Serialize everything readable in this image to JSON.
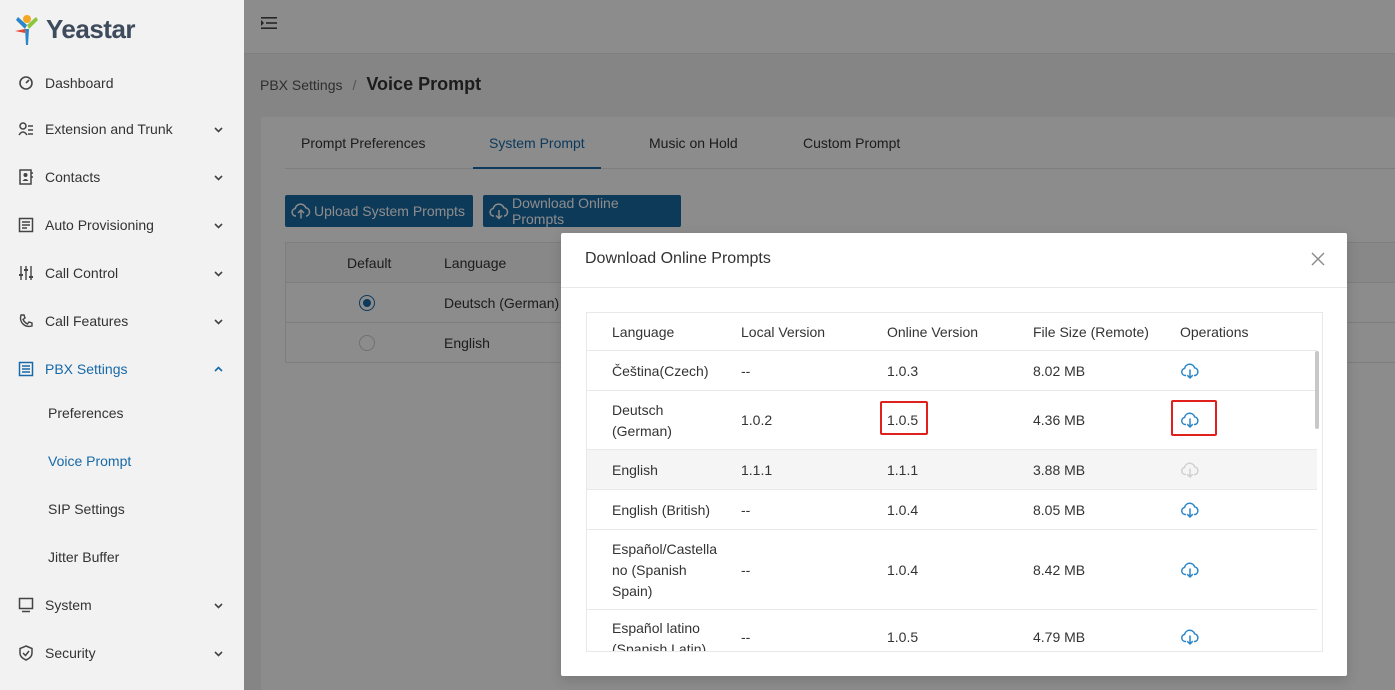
{
  "brand": {
    "name": "Yeastar"
  },
  "sidebar": {
    "items": [
      {
        "label": "Dashboard",
        "icon": "dashboard-icon"
      },
      {
        "label": "Extension and Trunk",
        "icon": "extension-icon"
      },
      {
        "label": "Contacts",
        "icon": "contacts-icon"
      },
      {
        "label": "Auto Provisioning",
        "icon": "provisioning-icon"
      },
      {
        "label": "Call Control",
        "icon": "call-control-icon"
      },
      {
        "label": "Call Features",
        "icon": "phone-icon"
      },
      {
        "label": "PBX Settings",
        "icon": "pbx-settings-icon"
      },
      {
        "label": "System",
        "icon": "system-icon"
      },
      {
        "label": "Security",
        "icon": "shield-icon"
      }
    ],
    "sub_items": [
      {
        "label": "Preferences"
      },
      {
        "label": "Voice Prompt"
      },
      {
        "label": "SIP Settings"
      },
      {
        "label": "Jitter Buffer"
      }
    ]
  },
  "breadcrumb": {
    "parent": "PBX Settings",
    "separator": "/",
    "current": "Voice Prompt"
  },
  "tabs": [
    {
      "label": "Prompt Preferences"
    },
    {
      "label": "System Prompt"
    },
    {
      "label": "Music on Hold"
    },
    {
      "label": "Custom Prompt"
    }
  ],
  "toolbar": {
    "upload_label": "Upload System Prompts",
    "download_label": "Download Online Prompts"
  },
  "bg_table": {
    "headers": {
      "default": "Default",
      "language": "Language"
    },
    "rows": [
      {
        "language": "Deutsch (German)",
        "default": true
      },
      {
        "language": "English",
        "default": false
      }
    ]
  },
  "modal": {
    "title": "Download Online Prompts",
    "headers": {
      "language": "Language",
      "local": "Local Version",
      "online": "Online Version",
      "size": "File Size (Remote)",
      "ops": "Operations"
    },
    "rows": [
      {
        "lang_lines": [
          "Čeština(Czech)"
        ],
        "local": "--",
        "online": "1.0.3",
        "size": "8.02 MB",
        "downloadable": true
      },
      {
        "lang_lines": [
          "Deutsch",
          "(German)"
        ],
        "local": "1.0.2",
        "online": "1.0.5",
        "size": "4.36 MB",
        "downloadable": true
      },
      {
        "lang_lines": [
          "English"
        ],
        "local": "1.1.1",
        "online": "1.1.1",
        "size": "3.88 MB",
        "downloadable": false
      },
      {
        "lang_lines": [
          "English (British)"
        ],
        "local": "--",
        "online": "1.0.4",
        "size": "8.05 MB",
        "downloadable": true
      },
      {
        "lang_lines": [
          "Español/Castella",
          "no (Spanish",
          "Spain)"
        ],
        "local": "--",
        "online": "1.0.4",
        "size": "8.42 MB",
        "downloadable": true
      },
      {
        "lang_lines": [
          "Español latino",
          "(Spanish Latin)"
        ],
        "local": "--",
        "online": "1.0.5",
        "size": "4.79 MB",
        "downloadable": true
      }
    ]
  },
  "colors": {
    "accent": "#1769a8",
    "button": "#1a6aa3",
    "highlight": "#e0201c",
    "icon_enabled": "#2b86c8",
    "icon_disabled": "#d0d0d0"
  }
}
